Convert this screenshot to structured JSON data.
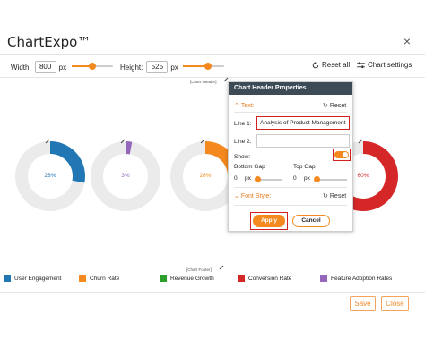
{
  "app": {
    "title": "ChartExpo™",
    "close_glyph": "×"
  },
  "toolbar": {
    "width_label": "Width:",
    "width_value": "800",
    "width_unit": "px",
    "width_level": 0.5,
    "height_label": "Height:",
    "height_value": "525",
    "height_unit": "px",
    "height_level": 0.6,
    "reset_all_label": "Reset all",
    "chart_settings_label": "Chart settings"
  },
  "chart": {
    "header_tag": "[Chart Header]",
    "footer_tag": "[Chart Footer]",
    "donuts": [
      {
        "name": "User Engagement",
        "percent_label": "28%",
        "value": 28,
        "color": "#2077b4"
      },
      {
        "name": "Churn Rate",
        "percent_label": "3%",
        "value": 3,
        "color": "#9467bd"
      },
      {
        "name": "Revenue Growth",
        "percent_label": "26%",
        "value": 26,
        "color": "#f4891f"
      },
      {
        "name": "Conversion Rate",
        "percent_label": "60%",
        "value": 60,
        "color": "#d62728"
      }
    ],
    "track_color": "#ebebeb"
  },
  "legend": [
    {
      "label": "User Engagement",
      "color": "#2077b4"
    },
    {
      "label": "Churn Rate",
      "color": "#f4891f"
    },
    {
      "label": "Revenue Growth",
      "color": "#2ca02c"
    },
    {
      "label": "Conversion Rate",
      "color": "#d62728"
    },
    {
      "label": "Feature Adoption Rates",
      "color": "#9467bd"
    }
  ],
  "footer": {
    "save_label": "Save",
    "close_label": "Close"
  },
  "popup": {
    "title": "Chart Header Properties",
    "text_section": "Text:",
    "text_reset": "Reset",
    "line1_label": "Line 1:",
    "line1_value": "Analysis of Product Management",
    "line2_label": "Line 2:",
    "line2_value": "",
    "show_label": "Show:",
    "show_value": true,
    "bottom_gap_label": "Bottom Gap",
    "bottom_gap_value": "0",
    "bottom_gap_unit": "px",
    "top_gap_label": "Top Gap",
    "top_gap_value": "0",
    "top_gap_unit": "px",
    "font_section": "Font Style:",
    "font_reset": "Reset",
    "apply_label": "Apply",
    "cancel_label": "Cancel"
  }
}
